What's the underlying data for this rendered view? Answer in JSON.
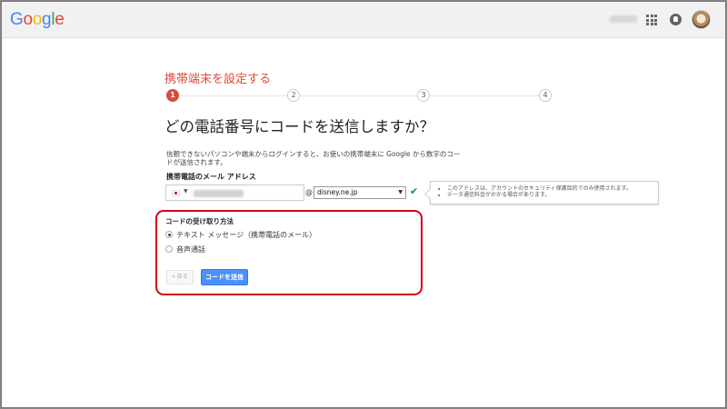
{
  "header": {
    "logo_letters": [
      {
        "ch": "G",
        "color": "#4285F4"
      },
      {
        "ch": "o",
        "color": "#EA4335"
      },
      {
        "ch": "o",
        "color": "#FBBC05"
      },
      {
        "ch": "g",
        "color": "#4285F4"
      },
      {
        "ch": "l",
        "color": "#34A853"
      },
      {
        "ch": "e",
        "color": "#EA4335"
      }
    ],
    "icons": [
      "apps-grid-icon",
      "notifications-icon",
      "avatar"
    ]
  },
  "stepper": {
    "title": "携帯端末を設定する",
    "steps": [
      "1",
      "2",
      "3",
      "4"
    ],
    "active_step": 1,
    "accent_color": "#dd4b39"
  },
  "main": {
    "heading": "どの電話番号にコードを送信しますか？",
    "description": "信頼できないパソコンや端末からログインすると、お使いの携帯端末に Google から数字のコードが送信されます。",
    "email_label": "携帯電話のメール アドレス",
    "at_sign": "@",
    "domain_value": "disney.ne.jp",
    "tooltip_items": [
      "このアドレスは、アカウントのセキュリティ保護目的でのみ使用されます。",
      "データ通信料金がかかる場合があります。"
    ]
  },
  "method": {
    "label": "コードの受け取り方法",
    "options": [
      {
        "label": "テキスト メッセージ（携帯電話のメール）",
        "checked": true
      },
      {
        "label": "音声通話",
        "checked": false
      }
    ]
  },
  "buttons": {
    "back_label": "« 戻る",
    "send_label": "コードを送信"
  },
  "colors": {
    "primary_button": "#4d90fe",
    "check": "#0a8f3c",
    "highlight": "#d4001a"
  }
}
